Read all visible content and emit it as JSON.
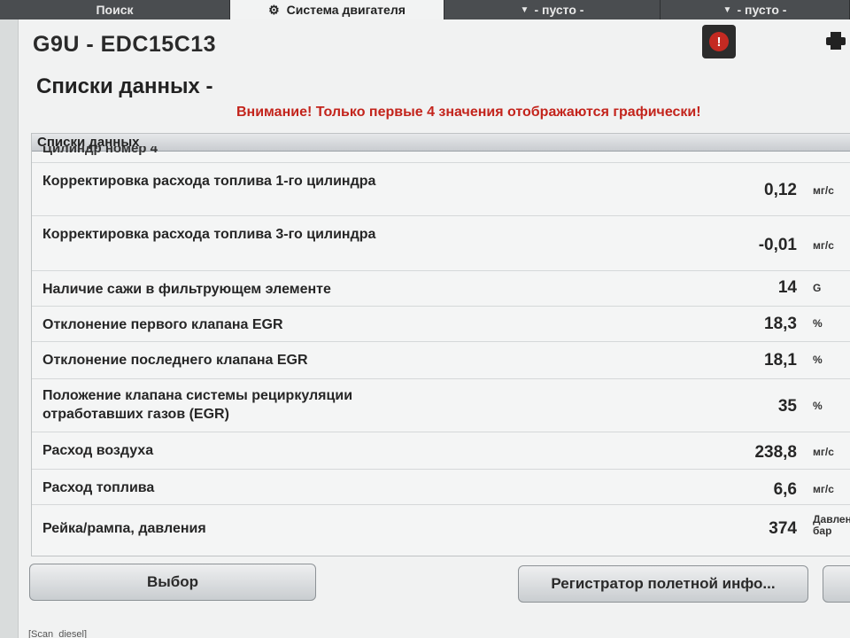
{
  "tabs": [
    {
      "label": "Поиск",
      "active": false
    },
    {
      "label": "Система двигателя",
      "active": true
    },
    {
      "label": "- пусто -",
      "active": false
    },
    {
      "label": "- пусто -",
      "active": false
    }
  ],
  "system": {
    "title": "G9U - EDC15C13"
  },
  "page": {
    "title": "Списки данных -",
    "warning": "Внимание! Только первые 4 значения отображаются графически!"
  },
  "list": {
    "header": "Списки данных",
    "cut_row": "Цилиндр номер 4",
    "rows": [
      {
        "label": "Корректировка расхода топлива 1-го цилиндра",
        "value": "0,12",
        "unit": "мг/с"
      },
      {
        "label": "Корректировка расхода топлива 3-го цилиндра",
        "value": "-0,01",
        "unit": "мг/с"
      },
      {
        "label": "Наличие сажи в фильтрующем элементе",
        "value": "14",
        "unit": "G"
      },
      {
        "label": "Отклонение первого клапана EGR",
        "value": "18,3",
        "unit": "%"
      },
      {
        "label": "Отклонение последнего клапана EGR",
        "value": "18,1",
        "unit": "%"
      },
      {
        "label": "Положение клапана системы рециркуляции отработавших газов (EGR)",
        "value": "35",
        "unit": "%"
      },
      {
        "label": "Расход воздуха",
        "value": "238,8",
        "unit": "мг/с"
      },
      {
        "label": "Расход топлива",
        "value": "6,6",
        "unit": "мг/с"
      },
      {
        "label": "Рейка/рампа, давления",
        "value": "374",
        "unit": "Давление бар"
      }
    ]
  },
  "buttons": {
    "select": "Выбор",
    "recorder": "Регистратор полетной инфо..."
  },
  "footer": {
    "text": "[Scan_diesel]"
  },
  "colors": {
    "warning": "#c3241c",
    "alert": "#c42a22",
    "tab_bar": "#5a5d60"
  },
  "icons": {
    "engine_tab": "engine-system-icon",
    "alert": "alert-icon",
    "printer": "printer-icon"
  }
}
